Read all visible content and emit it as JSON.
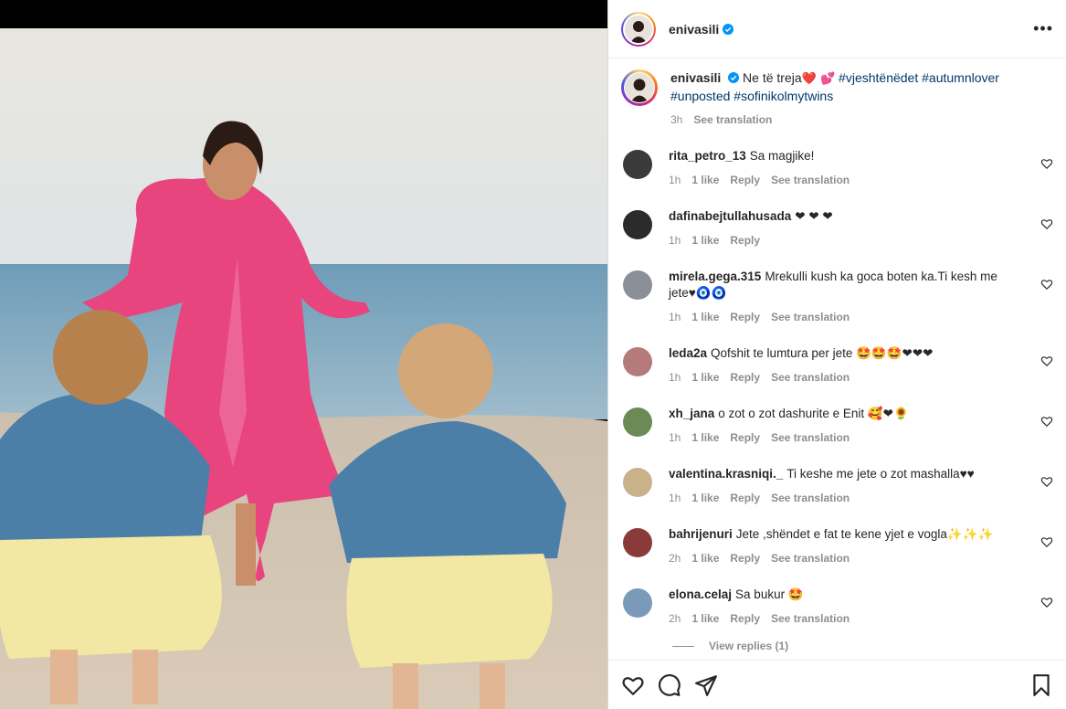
{
  "post": {
    "username": "enivasili",
    "more_label": "•••",
    "caption": {
      "text": "Ne të treja",
      "hearts": "❤️ 💕",
      "hashtags": [
        "#vjeshtënëdet",
        "#autumnlover",
        "#unposted",
        "#sofinikolmytwins"
      ],
      "time": "3h",
      "see_translation": "See translation"
    }
  },
  "comments": [
    {
      "user": "rita_petro_13",
      "text": "Sa magjike!",
      "time": "1h",
      "likes": "1 like",
      "reply": "Reply",
      "translation": "See translation",
      "avatar_color": "#3a3a3a"
    },
    {
      "user": "dafinabejtullahusada",
      "text": "❤ ❤ ❤",
      "time": "1h",
      "likes": "1 like",
      "reply": "Reply",
      "translation": "",
      "avatar_color": "#2b2b2b"
    },
    {
      "user": "mirela.gega.315",
      "text": "Mrekulli kush ka goca boten ka.Ti kesh me jete♥🧿🧿",
      "time": "1h",
      "likes": "1 like",
      "reply": "Reply",
      "translation": "See translation",
      "avatar_color": "#8a8f98"
    },
    {
      "user": "leda2a",
      "text": "Qofshit te lumtura per jete 🤩🤩🤩❤❤❤",
      "time": "1h",
      "likes": "1 like",
      "reply": "Reply",
      "translation": "See translation",
      "avatar_color": "#b57a7a"
    },
    {
      "user": "xh_jana",
      "text": "o zot o zot dashurite e Enit 🥰❤🌻",
      "time": "1h",
      "likes": "1 like",
      "reply": "Reply",
      "translation": "See translation",
      "avatar_color": "#6b8a55"
    },
    {
      "user": "valentina.krasniqi._",
      "text": "Ti keshe me jete o zot mashalla♥♥",
      "time": "1h",
      "likes": "1 like",
      "reply": "Reply",
      "translation": "See translation",
      "avatar_color": "#c9b28a"
    },
    {
      "user": "bahrijenuri",
      "text": "Jete ,shëndet e fat te kene yjet e vogla✨✨✨",
      "time": "2h",
      "likes": "1 like",
      "reply": "Reply",
      "translation": "See translation",
      "avatar_color": "#8b3a3a"
    },
    {
      "user": "elona.celaj",
      "text": "Sa bukur 🤩",
      "time": "2h",
      "likes": "1 like",
      "reply": "Reply",
      "translation": "See translation",
      "avatar_color": "#7a9ab8"
    }
  ],
  "view_replies": "View replies (1)",
  "actions": {
    "like_icon": "heart-icon",
    "comment_icon": "comment-icon",
    "share_icon": "share-icon",
    "save_icon": "bookmark-icon"
  },
  "colors": {
    "hashtag": "#00376b",
    "verified": "#0095f6",
    "muted": "#8e8e8e",
    "dress": "#e8457e",
    "dress_light": "#f0739e",
    "denim": "#4c7fa8",
    "skirt": "#f3e8a3"
  }
}
